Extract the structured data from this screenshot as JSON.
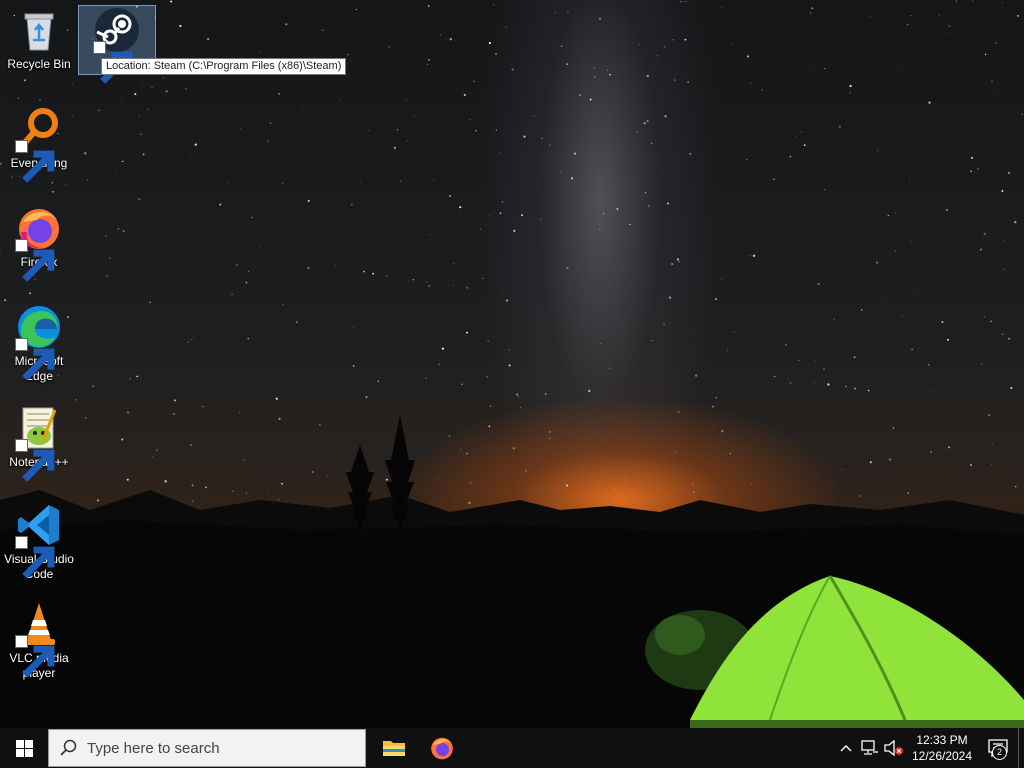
{
  "desktop_icons": [
    {
      "label": "Recycle Bin",
      "icon": "recycle-bin-icon"
    },
    {
      "label": "",
      "icon": "steam-icon",
      "selected": true
    },
    {
      "label": "Everything",
      "icon": "everything-icon"
    },
    {
      "label": "Firefox",
      "icon": "firefox-icon"
    },
    {
      "label": "Microsoft Edge",
      "icon": "edge-icon"
    },
    {
      "label": "Notepad++",
      "icon": "notepadpp-icon"
    },
    {
      "label": "Visual Studio Code",
      "icon": "vscode-icon"
    },
    {
      "label": "VLC media player",
      "icon": "vlc-icon"
    }
  ],
  "tooltip": {
    "text": "Location: Steam (C:\\Program Files (x86)\\Steam)"
  },
  "taskbar": {
    "search_placeholder": "Type here to search",
    "pinned_apps": [
      "file-explorer-icon",
      "firefox-icon"
    ],
    "tray_icons": [
      "chevron-up-icon",
      "network-icon",
      "volume-muted-icon"
    ],
    "clock": {
      "time": "12:33 PM",
      "date": "12/26/2024"
    },
    "notifications": {
      "count": "2"
    }
  },
  "colors": {
    "taskbar": "#101010",
    "search_box": "#f2f2f2",
    "tent_green": "#8fe33a",
    "horizon_glow": "#e46e1e"
  }
}
